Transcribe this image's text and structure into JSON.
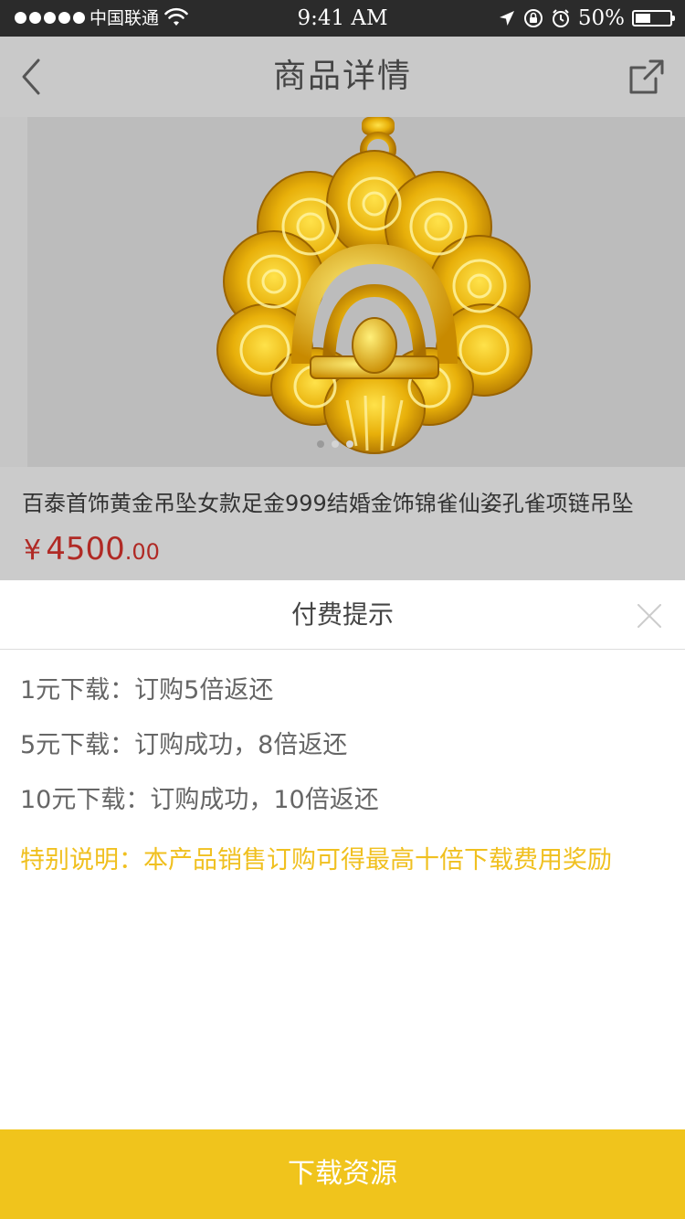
{
  "status_bar": {
    "carrier": "中国联通",
    "time": "9:41 AM",
    "battery_percent": "50%",
    "battery_level": 0.5,
    "signal_dots": 5
  },
  "nav": {
    "title": "商品详情",
    "back_icon": "chevron-left-icon",
    "share_icon": "share-icon"
  },
  "product": {
    "title": "百泰首饰黄金吊坠女款足金999结婚金饰锦雀仙姿孔雀项链吊坠",
    "price_symbol": "¥",
    "price_integer": "4500",
    "price_decimal": ".00",
    "image_icon": "gold-peacock-pendant-image",
    "carousel_count": 3,
    "carousel_active_index": 0
  },
  "payment_sheet": {
    "title": "付费提示",
    "lines": [
      "1元下载：订购5倍返还",
      "5元下载：订购成功，8倍返还",
      "10元下载：订购成功，10倍返还"
    ],
    "note": "特别说明：本产品销售订购可得最高十倍下载费用奖励"
  },
  "download_button": {
    "label": "下载资源"
  },
  "colors": {
    "accent_yellow": "#f0c41c",
    "price_red": "#b02a25",
    "note_yellow": "#f0c020",
    "overlay_gray": "#c9c9c9"
  }
}
